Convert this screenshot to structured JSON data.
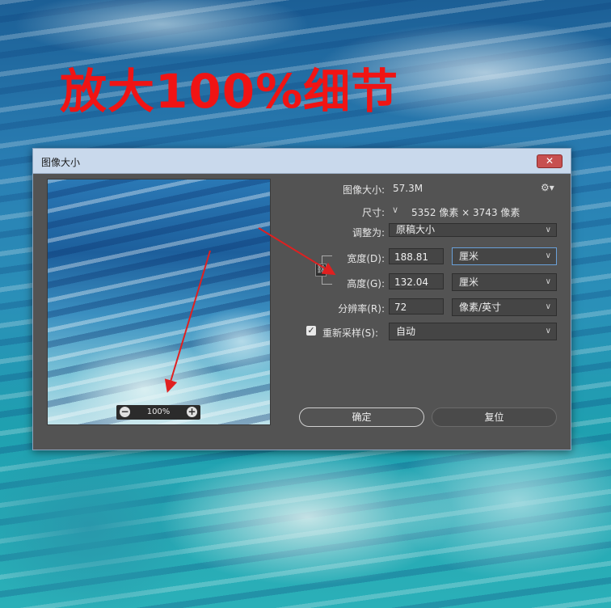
{
  "headline": "放大100%细节",
  "dialog": {
    "title": "图像大小",
    "close_label": "✕"
  },
  "preview": {
    "zoom_value": "100%",
    "zoom_out": "−",
    "zoom_in": "+"
  },
  "info": {
    "image_size_label": "图像大小:",
    "image_size_value": "57.3M",
    "dimensions_label": "尺寸:",
    "dimensions_value": "5352 像素 × 3743 像素"
  },
  "fit_to": {
    "label": "调整为:",
    "value": "原稿大小"
  },
  "width": {
    "label": "宽度(D):",
    "value": "188.81",
    "unit": "厘米"
  },
  "height": {
    "label": "高度(G):",
    "value": "132.04",
    "unit": "厘米"
  },
  "resolution": {
    "label": "分辨率(R):",
    "value": "72",
    "unit": "像素/英寸"
  },
  "resample": {
    "label": "重新采样(S):",
    "checked": true,
    "value": "自动"
  },
  "buttons": {
    "ok": "确定",
    "reset": "复位"
  },
  "colors": {
    "headline": "#f01414",
    "dialog_bg": "#535353",
    "arrow": "#e02020"
  },
  "icons": {
    "settings": "gear-icon",
    "link": "chain-link-icon"
  }
}
